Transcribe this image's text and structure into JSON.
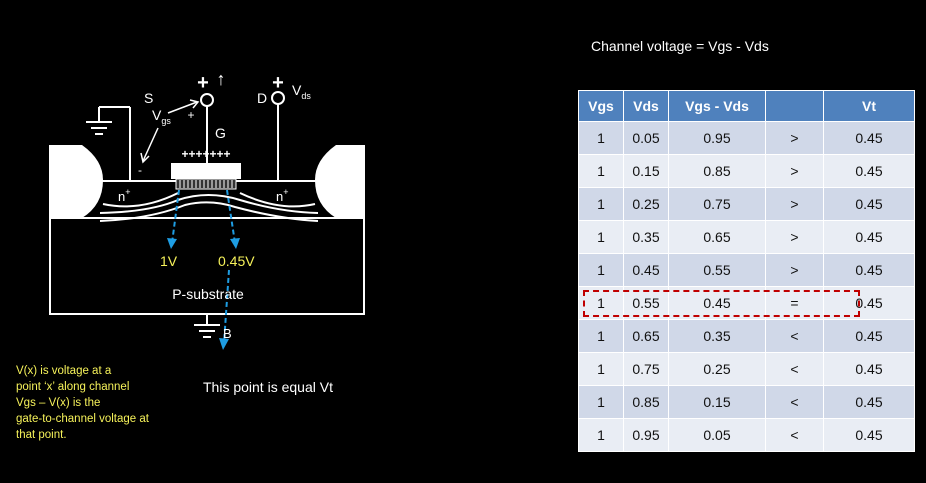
{
  "heading": "Channel voltage = Vgs - Vds",
  "diagram": {
    "source": "S",
    "gate": "G",
    "drain": "D",
    "bulk": "B",
    "vgs_main": "V",
    "vgs_sub": "gs",
    "vds_main": "V",
    "vds_sub": "ds",
    "gate_plus": "+",
    "gate_arrow": "↑",
    "drain_plus": "+",
    "small_plus": "+",
    "small_minus": "-",
    "gate_charges": "+++++++",
    "n_left": "n",
    "n_right": "n",
    "n_sup": "+",
    "substrate": "P-substrate",
    "v_left": "1V",
    "v_right": "0.45V"
  },
  "note_lines": [
    "V(x) is voltage at a",
    "point ‘x’ along channel",
    "Vgs – V(x) is the",
    "gate-to-channel voltage at",
    "that point."
  ],
  "point_label": "This point is equal Vt",
  "table": {
    "headers": [
      "Vgs",
      "Vds",
      "Vgs - Vds",
      "",
      "Vt"
    ],
    "rows": [
      [
        "1",
        "0.05",
        "0.95",
        ">",
        "0.45"
      ],
      [
        "1",
        "0.15",
        "0.85",
        ">",
        "0.45"
      ],
      [
        "1",
        "0.25",
        "0.75",
        ">",
        "0.45"
      ],
      [
        "1",
        "0.35",
        "0.65",
        ">",
        "0.45"
      ],
      [
        "1",
        "0.45",
        "0.55",
        ">",
        "0.45"
      ],
      [
        "1",
        "0.55",
        "0.45",
        "=",
        "0.45"
      ],
      [
        "1",
        "0.65",
        "0.35",
        "<",
        "0.45"
      ],
      [
        "1",
        "0.75",
        "0.25",
        "<",
        "0.45"
      ],
      [
        "1",
        "0.85",
        "0.15",
        "<",
        "0.45"
      ],
      [
        "1",
        "0.95",
        "0.05",
        "<",
        "0.45"
      ]
    ],
    "highlight_row": 5
  },
  "colors": {
    "header_bg": "#4f81bd",
    "row_odd": "#d0d8e8",
    "row_even": "#e9edf4",
    "highlight": "#c00000",
    "note_text": "#f6f25a",
    "arrow": "#1e9de3",
    "voltage_label": "#f6f25a"
  }
}
